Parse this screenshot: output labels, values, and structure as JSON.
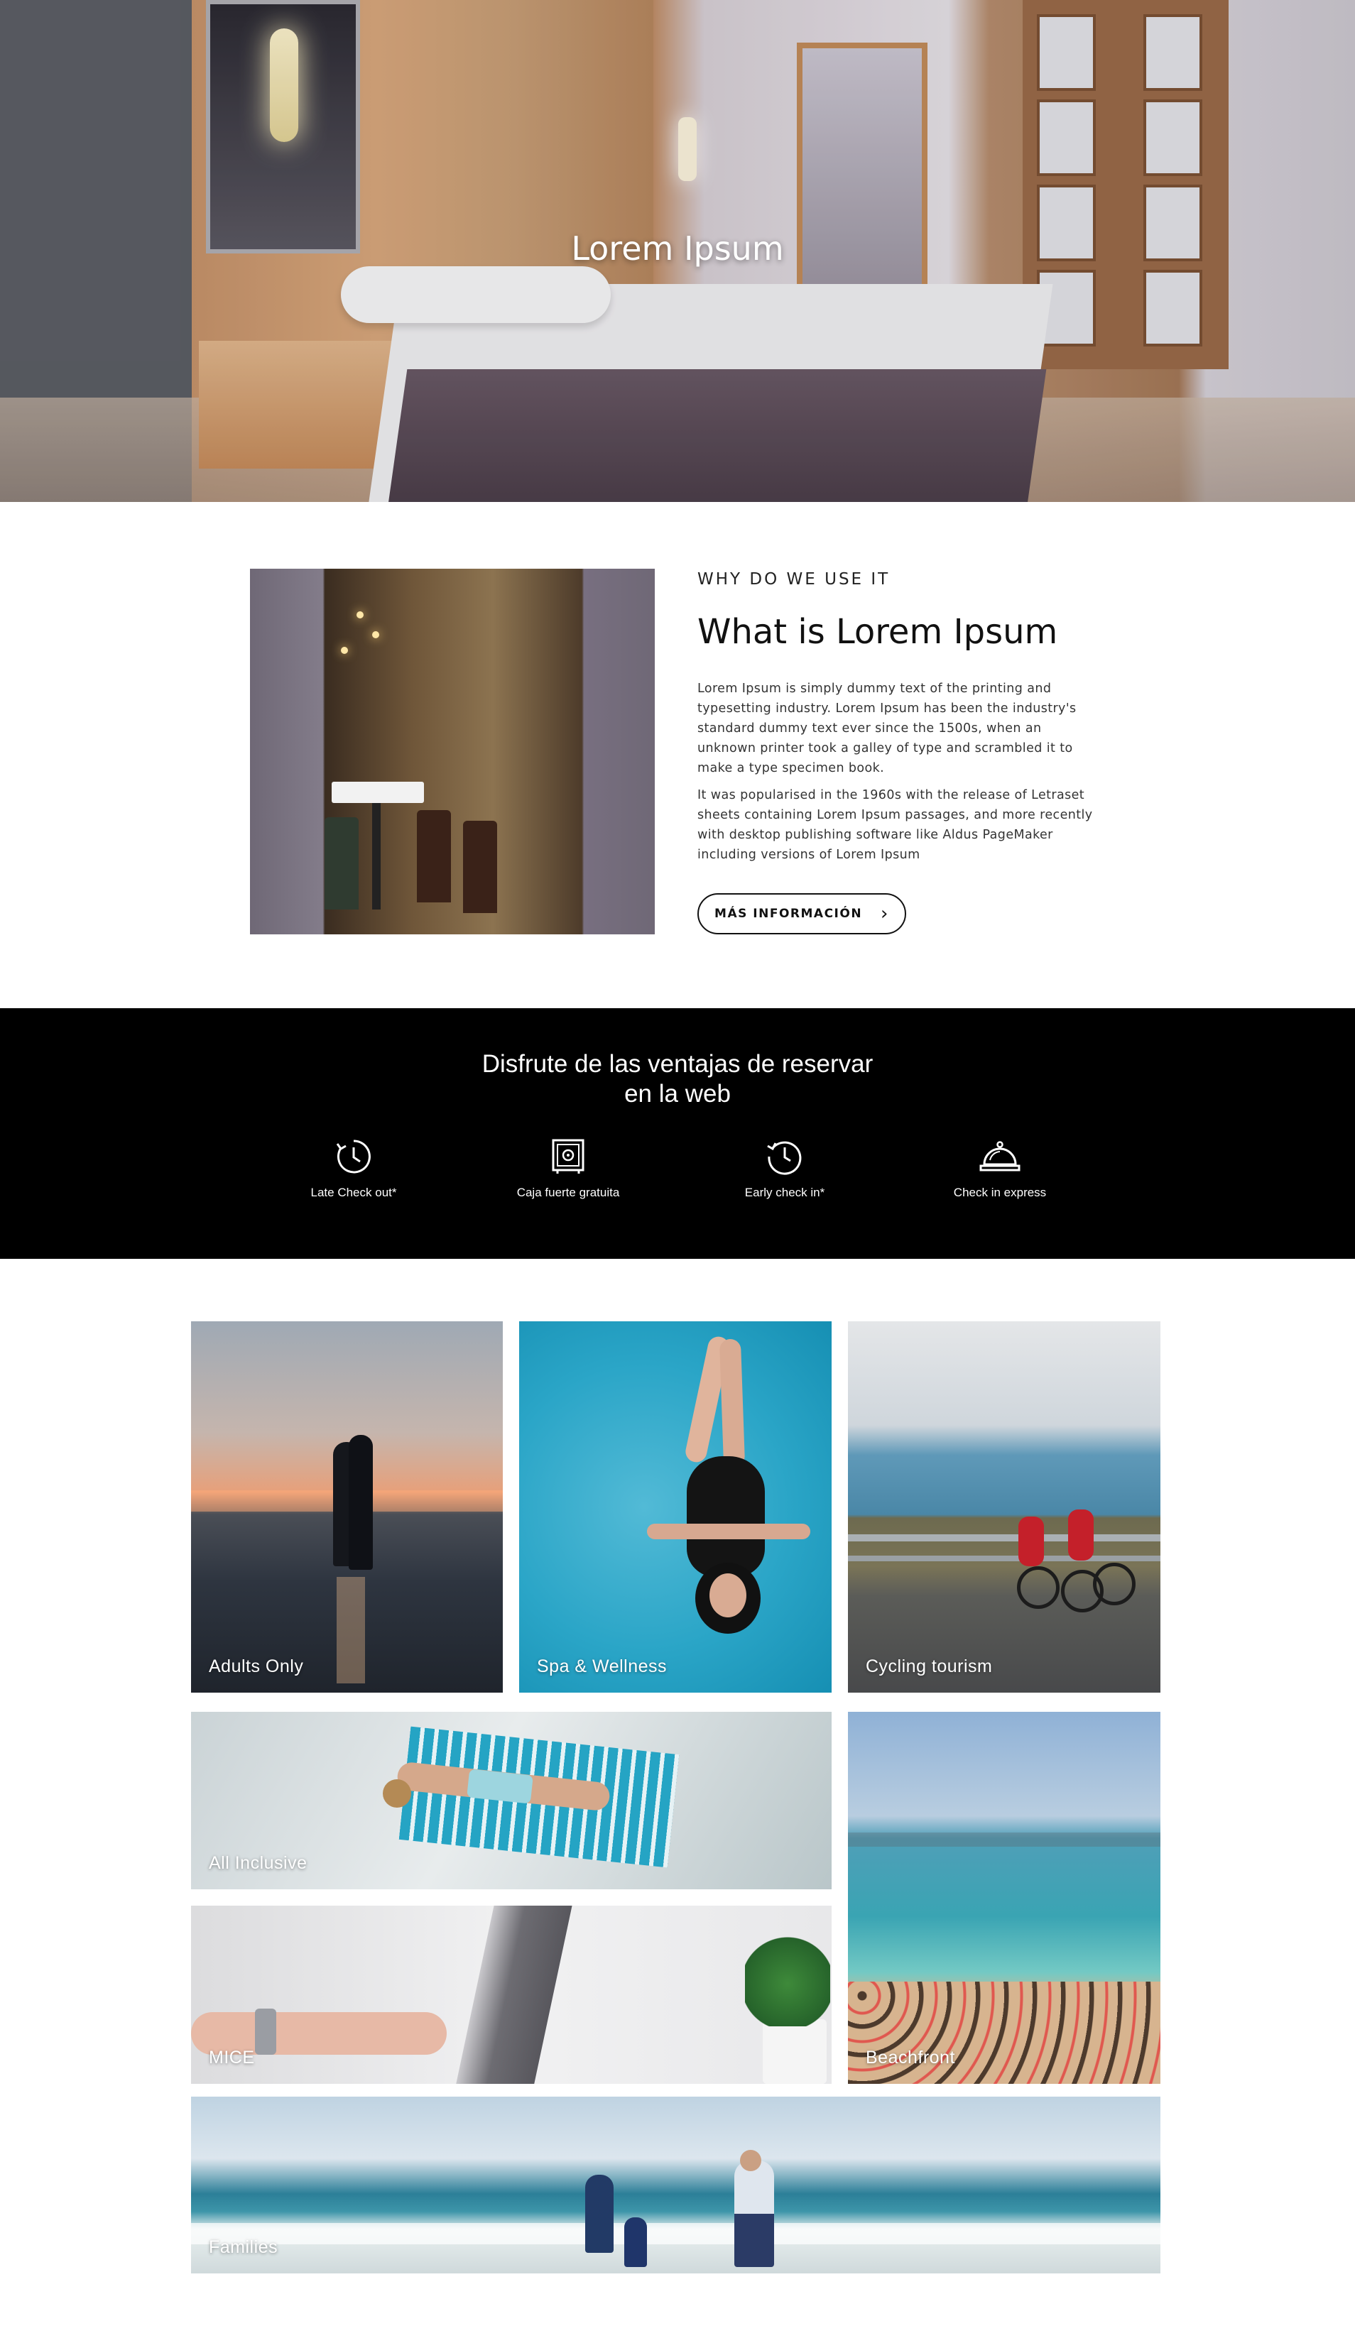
{
  "hero": {
    "title": "Lorem Ipsum"
  },
  "intro": {
    "eyebrow": "WHY DO WE USE IT",
    "title": "What is Lorem Ipsum",
    "paragraph1": "Lorem Ipsum is simply dummy text of the printing and typesetting industry. Lorem Ipsum has been the industry's standard dummy text ever since the 1500s, when an unknown printer took a galley of type and scrambled it to make a type specimen book.",
    "paragraph2": "It was popularised in the 1960s with the release of Letraset sheets containing Lorem Ipsum passages, and more recently with desktop publishing software like Aldus PageMaker including versions of Lorem Ipsum",
    "button_label": "MÁS INFORMACIÓN"
  },
  "benefits": {
    "title_line1": "Disfrute de las ventajas de reservar",
    "title_line2": "en la web",
    "items": [
      {
        "label": "Late Check out*",
        "icon": "late-checkout-clock-icon"
      },
      {
        "label": "Caja fuerte gratuita",
        "icon": "safe-box-icon"
      },
      {
        "label": "Early check in*",
        "icon": "early-checkin-history-icon"
      },
      {
        "label": "Check in express",
        "icon": "reception-bell-icon"
      }
    ]
  },
  "tiles": [
    {
      "label": "Adults Only"
    },
    {
      "label": "Spa & Wellness"
    },
    {
      "label": "Cycling tourism"
    },
    {
      "label": "All Inclusive"
    },
    {
      "label": "MICE"
    },
    {
      "label": "Beachfront"
    },
    {
      "label": "Families"
    }
  ]
}
